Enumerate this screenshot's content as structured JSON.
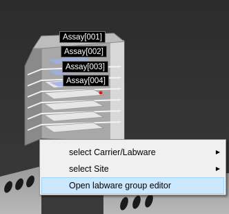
{
  "labware_labels": [
    "Assay[001]",
    "Assay[002]",
    "Assay[003]",
    "Assay[004]"
  ],
  "context_menu": {
    "items": [
      {
        "label": "select Carrier/Labware",
        "has_submenu": true,
        "highlighted": false
      },
      {
        "label": "select Site",
        "has_submenu": true,
        "highlighted": false
      },
      {
        "label": "Open labware group editor",
        "has_submenu": false,
        "highlighted": true
      }
    ]
  },
  "icons": {
    "submenu_arrow": "chevron-right-icon"
  },
  "colors": {
    "viewport_background": "#2f2f2f",
    "menu_background": "#f0f0f0",
    "menu_highlight": "#cce8ff",
    "label_background": "#000000"
  }
}
